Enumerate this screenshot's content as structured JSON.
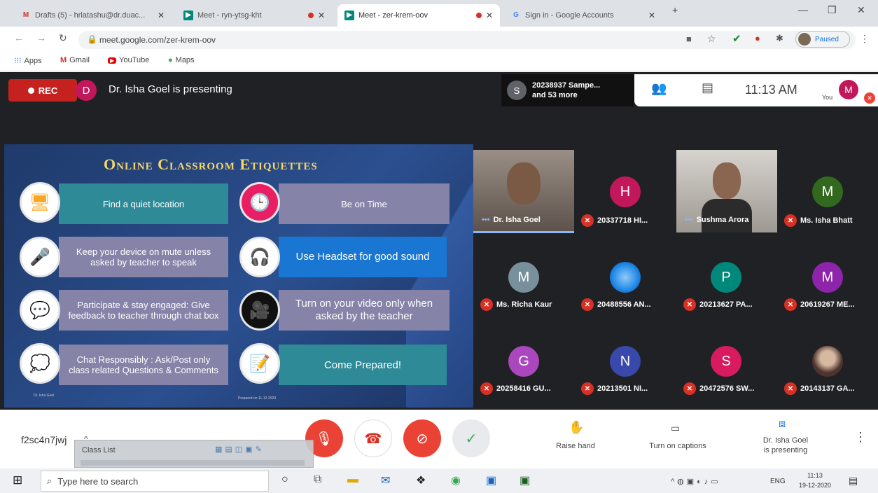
{
  "browser": {
    "tabs": [
      {
        "favicon": "gmail-icon",
        "title": "Drafts (5) - hrlatashu@dr.duac...",
        "active": false
      },
      {
        "favicon": "meet-icon",
        "title": "Meet - ryn-ytsg-kht",
        "active": false
      },
      {
        "favicon": "meet-icon",
        "title": "Meet - zer-krem-oov",
        "active": true
      },
      {
        "favicon": "google-icon",
        "title": "Sign in - Google Accounts",
        "active": false
      }
    ],
    "url": "meet.google.com/zer-krem-oov",
    "profile_label": "Paused",
    "bookmarks": [
      "Apps",
      "Gmail",
      "YouTube",
      "Maps"
    ]
  },
  "meet": {
    "rec_label": "REC",
    "presenter_initial": "D",
    "presenting_text": "Dr. Isha Goel is presenting",
    "others": {
      "initial": "S",
      "line1": "20238937 Sampe...",
      "line2": "and 53 more"
    },
    "time": "11:13 AM",
    "you_label": "You",
    "me_initial": "M"
  },
  "slide": {
    "title": "Online Classroom Etiquettes",
    "left_items": [
      "Find a quiet location",
      "Keep your device on mute unless asked by teacher to speak",
      "Participate & stay engaged: Give feedback to teacher through chat box",
      "Chat Responsibly : Ask/Post only class related Questions & Comments"
    ],
    "right_items": [
      "Be on Time",
      "Use Headset for good sound",
      "Turn on your video only when asked by the teacher",
      "Come Prepared!"
    ],
    "footer_left": "Dr. Isha Goel",
    "footer_right": "Prepared on 11-12-2020"
  },
  "participants": [
    {
      "name": "Dr. Isha Goel",
      "initial": "",
      "color": "",
      "video": true,
      "muted": false
    },
    {
      "name": "20337718 HI...",
      "initial": "H",
      "color": "#c2185b",
      "video": false,
      "muted": true
    },
    {
      "name": "Sushma Arora",
      "initial": "",
      "color": "",
      "video": true,
      "muted": false
    },
    {
      "name": "Ms. Isha Bhatt",
      "initial": "M",
      "color": "#33691e",
      "video": false,
      "muted": true
    },
    {
      "name": "Ms. Richa Kaur",
      "initial": "M",
      "color": "#78909c",
      "video": false,
      "muted": true
    },
    {
      "name": "20488556 AN...",
      "initial": "",
      "color": "#1e88e5",
      "video": false,
      "muted": true
    },
    {
      "name": "20213627 PA...",
      "initial": "P",
      "color": "#00897b",
      "video": false,
      "muted": true
    },
    {
      "name": "20619267 ME...",
      "initial": "M",
      "color": "#8e24aa",
      "video": false,
      "muted": true
    },
    {
      "name": "20258416 GU...",
      "initial": "G",
      "color": "#ab47bc",
      "video": false,
      "muted": true
    },
    {
      "name": "20213501 NI...",
      "initial": "N",
      "color": "#3949ab",
      "video": false,
      "muted": true
    },
    {
      "name": "20472576 SW...",
      "initial": "S",
      "color": "#d81b60",
      "video": false,
      "muted": true
    },
    {
      "name": "20143137 GA...",
      "initial": "",
      "color": "#795548",
      "video": false,
      "muted": true
    }
  ],
  "controls": {
    "meeting_code": "f2sc4n7jwj",
    "raise_hand": "Raise hand",
    "captions": "Turn on captions",
    "presenting_line1": "Dr. Isha Goel",
    "presenting_line2": "is presenting",
    "class_list": "Class List"
  },
  "taskbar": {
    "search_placeholder": "Type here to search",
    "lang": "ENG",
    "time": "11:13",
    "date": "19-12-2020"
  }
}
